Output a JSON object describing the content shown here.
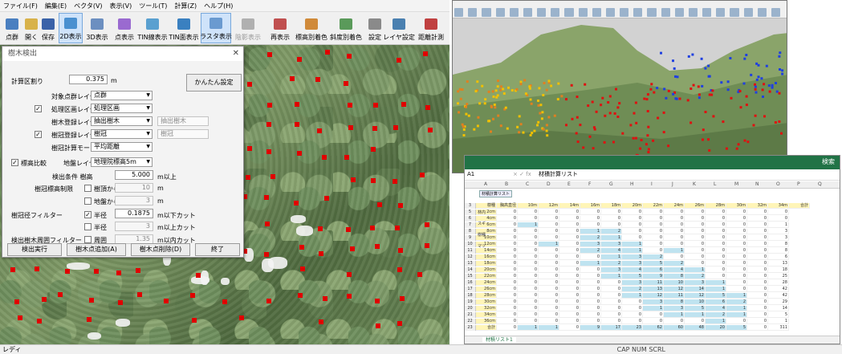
{
  "menu": [
    "ファイル(F)",
    "編集(E)",
    "ベクタ(V)",
    "表示(V)",
    "ツール(T)",
    "計算(Z)",
    "ヘルプ(H)"
  ],
  "toolbar": [
    {
      "label": "点群",
      "on": false,
      "dim": false,
      "color": "#4a7fc0"
    },
    {
      "label": "開く",
      "on": false,
      "dim": false,
      "color": "#d8b24a"
    },
    {
      "label": "保存",
      "on": false,
      "dim": false,
      "color": "#3a62a8"
    },
    {
      "label": "2D表示",
      "on": true,
      "dim": false,
      "color": "#4a90d0"
    },
    {
      "label": "3D表示",
      "on": false,
      "dim": false,
      "color": "#6c8fc0"
    },
    {
      "label": "点表示",
      "on": false,
      "dim": false,
      "color": "#9a6ad0"
    },
    {
      "label": "TIN線表示",
      "on": false,
      "dim": false,
      "color": "#5aa0d0"
    },
    {
      "label": "TIN面表示",
      "on": false,
      "dim": false,
      "color": "#3a80c0"
    },
    {
      "label": "ラスタ表示",
      "on": true,
      "dim": false,
      "color": "#6a9ad0"
    },
    {
      "label": "陰影表示",
      "on": false,
      "dim": true,
      "color": "#b0b0b0"
    },
    {
      "label": "再表示",
      "on": false,
      "dim": false,
      "color": "#c05050"
    },
    {
      "label": "標高別着色",
      "on": false,
      "dim": false,
      "color": "#d08a3a"
    },
    {
      "label": "斜度別着色",
      "on": false,
      "dim": false,
      "color": "#5a9a5a"
    },
    {
      "label": "設定",
      "on": false,
      "dim": false,
      "color": "#8a8a8a"
    },
    {
      "label": "レイヤ設定",
      "on": false,
      "dim": false,
      "color": "#4a80b0"
    },
    {
      "label": "距離計測",
      "on": false,
      "dim": false,
      "color": "#c04040"
    }
  ],
  "dialog": {
    "title": "樹木検出",
    "close": "✕",
    "calc_area": {
      "label": "計算区割り",
      "value": "0.375",
      "unit": "m"
    },
    "easy_button": "かんたん設定",
    "target_layer": {
      "label": "対象点群レイヤ",
      "value": "点群"
    },
    "area_layer": {
      "label": "処理区画レイヤ",
      "value": "処理区画",
      "checked": "✓"
    },
    "stem_layer": {
      "label": "樹木登録レイヤ",
      "value": "抽出樹木",
      "side": "抽出樹木"
    },
    "crown_layer": {
      "label": "樹冠登録レイヤ",
      "value": "樹冠",
      "side": "樹冠",
      "checked": "✓"
    },
    "crown_mode": {
      "label": "樹冠計算モード",
      "value": "平均距離"
    },
    "elev_compare": {
      "label": "標高比較",
      "checked": "✓",
      "ground_label": "地盤レイヤ",
      "ground_value": "地理院標高5m"
    },
    "extract": {
      "label": "検出条件 樹高",
      "value": "5.000",
      "unit": "m以上"
    },
    "crown_elev": {
      "label": "樹冠標高制限",
      "from_top": "樹頂から",
      "top_value": "10",
      "top_unit": "m",
      "from_ground": "地盤から",
      "ground_value": "3",
      "ground_unit": "m"
    },
    "crown_filter": {
      "label": "樹冠径フィルター",
      "radius": "半径",
      "radius_value": "0.1875",
      "radius_unit": "m以下カット",
      "radius_checked": "✓",
      "half": "半径",
      "half_value": "3",
      "half_unit": "m以上カット"
    },
    "peri_filter": {
      "label": "検出樹木周囲フィルター",
      "peri": "周囲",
      "peri_value": "1.35",
      "peri_unit": "m以内カット"
    },
    "buttons": [
      "検出実行",
      "樹木点追加(A)",
      "樹木点削除(D)",
      "終了"
    ]
  },
  "status": {
    "left": "レディ",
    "right": "CAP NUM SCRL"
  },
  "excel": {
    "name_box": "A1",
    "formula": "材積計算リスト",
    "title_btn": "材積計算リスト",
    "tab": "材積リスト1",
    "search": "検索",
    "columns": [
      "A",
      "B",
      "C",
      "D",
      "E",
      "F",
      "G",
      "H",
      "I",
      "J",
      "K",
      "L",
      "M",
      "N",
      "O",
      "P",
      "Q"
    ],
    "head_row": [
      "樹種",
      "胸高直径",
      "10m",
      "12m",
      "14m",
      "16m",
      "18m",
      "20m",
      "22m",
      "24m",
      "26m",
      "28m",
      "30m",
      "32m",
      "34m",
      "合計"
    ],
    "rows": [
      [
        "2cm",
        "0",
        "0",
        "0",
        "0",
        "0",
        "0",
        "0",
        "0",
        "0",
        "0",
        "0",
        "0",
        "0",
        "0"
      ],
      [
        "4cm",
        "0",
        "0",
        "0",
        "0",
        "0",
        "0",
        "0",
        "0",
        "0",
        "0",
        "0",
        "0",
        "0",
        "0"
      ],
      [
        "6cm",
        "0",
        "1",
        "0",
        "0",
        "0",
        "0",
        "0",
        "0",
        "0",
        "0",
        "0",
        "0",
        "0",
        "1"
      ],
      [
        "8cm",
        "0",
        "0",
        "0",
        "0",
        "1",
        "2",
        "0",
        "0",
        "0",
        "0",
        "0",
        "0",
        "0",
        "3"
      ],
      [
        "10cm",
        "0",
        "0",
        "0",
        "0",
        "2",
        "1",
        "0",
        "0",
        "0",
        "0",
        "0",
        "0",
        "0",
        "3"
      ],
      [
        "12cm",
        "0",
        "0",
        "1",
        "0",
        "3",
        "3",
        "1",
        "0",
        "0",
        "0",
        "0",
        "0",
        "0",
        "8"
      ],
      [
        "14cm",
        "0",
        "0",
        "0",
        "0",
        "2",
        "4",
        "1",
        "0",
        "1",
        "0",
        "0",
        "0",
        "0",
        "8"
      ],
      [
        "16cm",
        "0",
        "0",
        "0",
        "0",
        "0",
        "1",
        "3",
        "2",
        "0",
        "0",
        "0",
        "0",
        "0",
        "6"
      ],
      [
        "18cm",
        "0",
        "0",
        "0",
        "0",
        "1",
        "2",
        "3",
        "5",
        "2",
        "0",
        "0",
        "0",
        "0",
        "13"
      ],
      [
        "20cm",
        "0",
        "0",
        "0",
        "0",
        "0",
        "3",
        "4",
        "6",
        "4",
        "1",
        "0",
        "0",
        "0",
        "18"
      ],
      [
        "22cm",
        "0",
        "0",
        "0",
        "0",
        "0",
        "1",
        "5",
        "9",
        "8",
        "2",
        "0",
        "0",
        "0",
        "25"
      ],
      [
        "24cm",
        "0",
        "0",
        "0",
        "0",
        "0",
        "0",
        "3",
        "11",
        "10",
        "3",
        "1",
        "0",
        "0",
        "28"
      ],
      [
        "26cm",
        "0",
        "0",
        "0",
        "0",
        "0",
        "0",
        "2",
        "13",
        "12",
        "14",
        "1",
        "0",
        "0",
        "42"
      ],
      [
        "28cm",
        "0",
        "0",
        "0",
        "0",
        "0",
        "0",
        "1",
        "12",
        "11",
        "12",
        "5",
        "1",
        "0",
        "42"
      ],
      [
        "30cm",
        "0",
        "0",
        "0",
        "0",
        "0",
        "0",
        "0",
        "3",
        "8",
        "10",
        "6",
        "2",
        "0",
        "29"
      ],
      [
        "32cm",
        "0",
        "0",
        "0",
        "0",
        "0",
        "0",
        "0",
        "1",
        "3",
        "5",
        "4",
        "1",
        "0",
        "14"
      ],
      [
        "34cm",
        "0",
        "0",
        "0",
        "0",
        "0",
        "0",
        "0",
        "0",
        "1",
        "1",
        "2",
        "1",
        "0",
        "5"
      ],
      [
        "36cm",
        "0",
        "0",
        "0",
        "0",
        "0",
        "0",
        "0",
        "0",
        "0",
        "0",
        "1",
        "0",
        "0",
        "1"
      ],
      [
        "合計",
        "0",
        "1",
        "1",
        "0",
        "9",
        "17",
        "23",
        "62",
        "60",
        "48",
        "20",
        "5",
        "0",
        "311"
      ]
    ],
    "species": [
      "林内",
      "スギ",
      "樹種",
      "マツ"
    ]
  },
  "colors": {
    "excel_green": "#217346",
    "tree_mark": "#e00000",
    "row_highlight": "#bfe3f0",
    "head_yellow": "#fff5b8"
  }
}
